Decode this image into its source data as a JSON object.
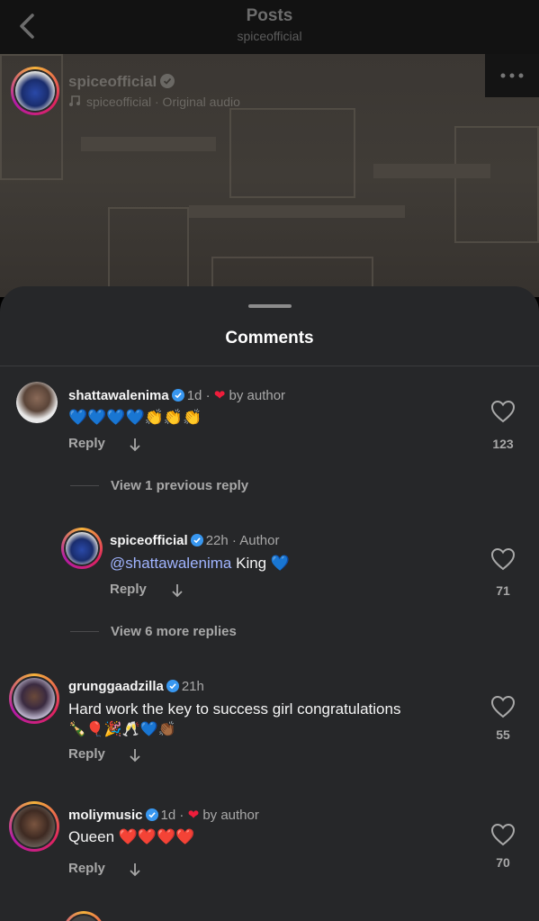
{
  "header": {
    "title": "Posts",
    "subtitle": "spiceofficial"
  },
  "post": {
    "username": "spiceofficial",
    "audio": "spiceofficial · Original audio"
  },
  "sheet": {
    "title": "Comments"
  },
  "comments": [
    {
      "username": "shattawalenima",
      "time": "1d",
      "badge": "by author",
      "text": "💙💙💙💙👏👏👏",
      "reply_label": "Reply",
      "likes": "123"
    },
    {
      "username": "spiceofficial",
      "time": "22h",
      "badge": "Author",
      "mention": "@shattawalenima",
      "text": " King 💙",
      "reply_label": "Reply",
      "likes": "71"
    },
    {
      "username": "grunggaadzilla",
      "time": "21h",
      "text": "Hard work the key to success girl congratulations",
      "text2": "🍾🎈🎉🥂💙👏🏾",
      "reply_label": "Reply",
      "likes": "55"
    },
    {
      "username": "moliymusic",
      "time": "1d",
      "badge": "by author",
      "text": "Queen ❤️❤️❤️❤️",
      "reply_label": "Reply",
      "likes": "70"
    }
  ],
  "threads": {
    "view_previous": "View 1 previous reply",
    "view_more": "View 6 more replies"
  },
  "colors": {
    "sheet_bg": "#262729",
    "verified_blue": "#3897f0",
    "heart_red": "#ef1d3b",
    "mention": "#a0b4ff"
  }
}
